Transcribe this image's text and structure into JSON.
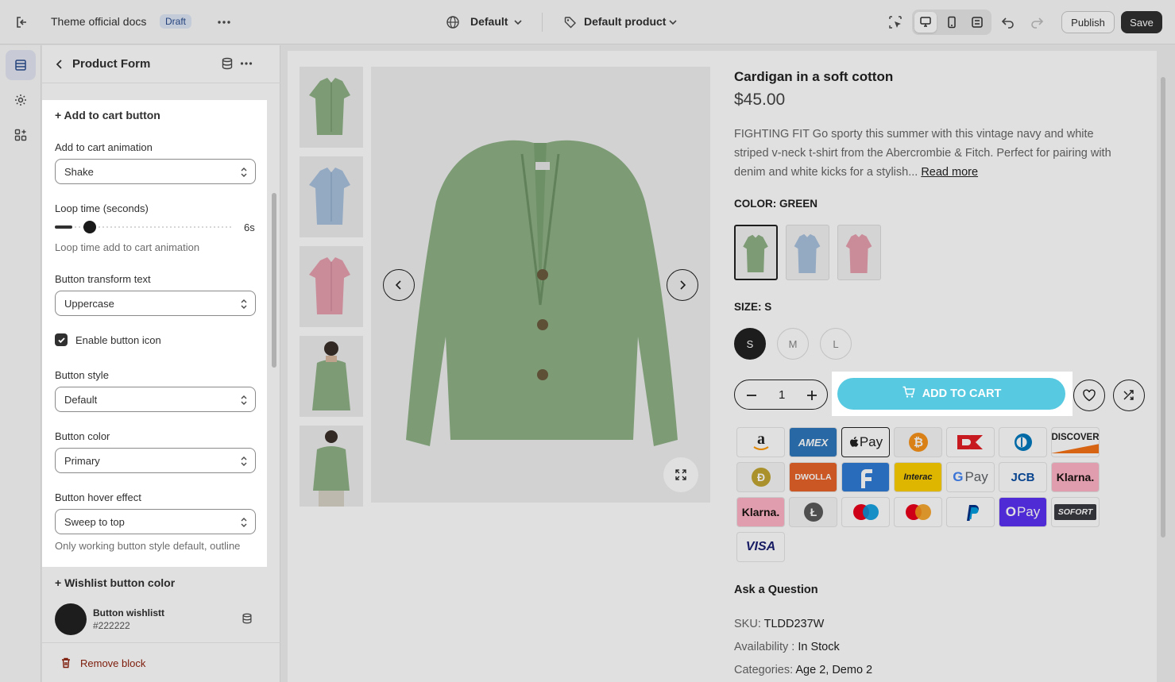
{
  "topbar": {
    "theme_name": "Theme official docs",
    "status_badge": "Draft",
    "locale_selector": "Default",
    "template_selector": "Default product",
    "publish_label": "Publish",
    "save_label": "Save"
  },
  "panel": {
    "title": "Product Form",
    "section_title": "+ Add to cart button",
    "animation_label": "Add to cart animation",
    "animation_value": "Shake",
    "loop_label": "Loop time (seconds)",
    "loop_value": 6,
    "loop_display": "6s",
    "loop_help": "Loop time add to cart animation",
    "transform_label": "Button transform text",
    "transform_value": "Uppercase",
    "icon_checkbox_label": "Enable button icon",
    "icon_checkbox_checked": true,
    "style_label": "Button style",
    "style_value": "Default",
    "color_label": "Button color",
    "color_value": "Primary",
    "hover_label": "Button hover effect",
    "hover_value": "Sweep to top",
    "hover_help": "Only working button style default, outline",
    "wishlist_section": "+ Wishlist button color",
    "wishlist_swatch_name": "Button wishlistt",
    "wishlist_swatch_hex": "#222222",
    "remove_label": "Remove block"
  },
  "product": {
    "title": "Cardigan in a soft cotton",
    "price": "$45.00",
    "description": "FIGHTING FIT Go sporty this summer with this vintage navy and white striped v-neck t-shirt from the Abercrombie & Fitch. Perfect for pairing with denim and white kicks for a stylish...",
    "read_more": "Read more",
    "color_label": "COLOR: GREEN",
    "size_label": "SIZE: S",
    "sizes": [
      "S",
      "M",
      "L"
    ],
    "quantity": "1",
    "add_to_cart": "ADD TO CART",
    "ask_question": "Ask a Question",
    "sku_label": "SKU:",
    "sku_value": "TLDD237W",
    "availability_label": "Availability :",
    "availability_value": "In Stock",
    "categories_label": "Categories:",
    "categories_value": "Age 2, Demo 2"
  },
  "payments": [
    "amazon-pay",
    "amex",
    "apple-pay",
    "bitcoin",
    "dankort",
    "diners-club",
    "discover",
    "dogecoin",
    "dwolla",
    "forbrugsforeningen",
    "interac",
    "google-pay",
    "jcb",
    "klarna",
    "klarna",
    "litecoin",
    "maestro",
    "mastercard",
    "paypal",
    "shop-pay",
    "sofort",
    "visa"
  ],
  "payment_texts": {
    "amex": "AMEX",
    "apple_pay": "Pay",
    "dwolla": "DWOLLA",
    "interac": "Interac",
    "google_pay": "Pay",
    "klarna": "Klarna.",
    "shop_pay": "Pay",
    "sofort": "SOFORT",
    "visa": "VISA",
    "discover": "DISCOVER",
    "jcb": "JCB"
  },
  "colors": {
    "accent_cyan": "#57c9e0",
    "sweater_green": "#8fb287",
    "sweater_blue": "#a9c2de",
    "sweater_pink": "#e7a0b0",
    "draft_badge": "#dfe7f7"
  }
}
